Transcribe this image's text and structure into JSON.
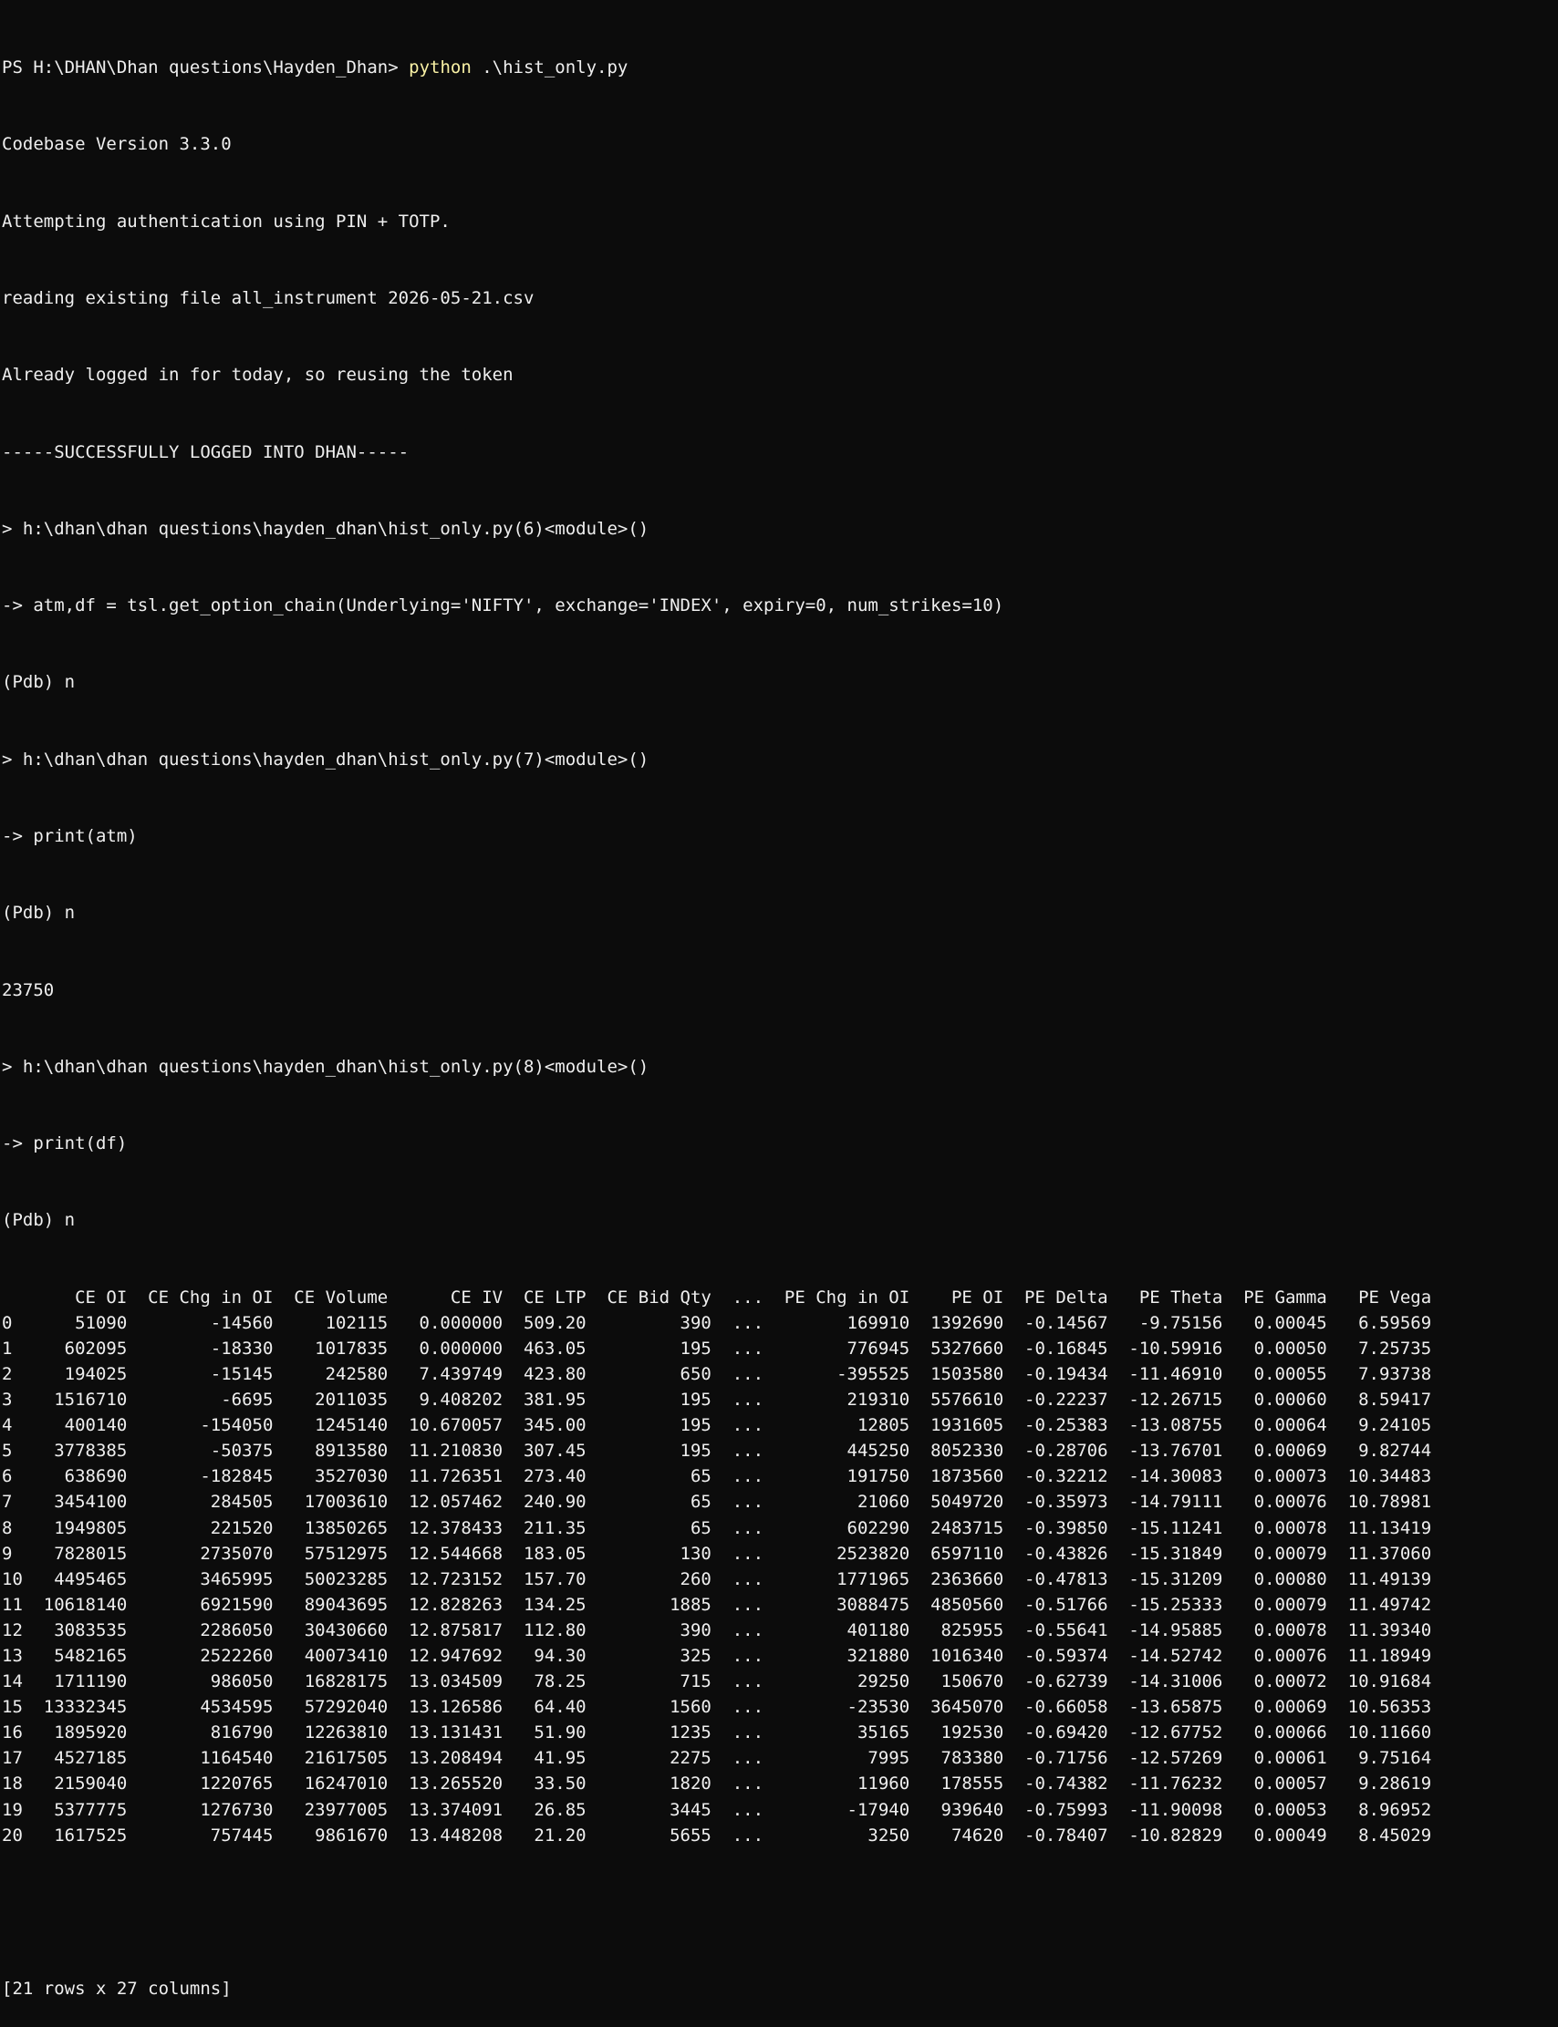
{
  "prompt": {
    "path": "PS H:\\DHAN\\Dhan questions\\Hayden_Dhan>",
    "command": "python",
    "args": " .\\hist_only.py"
  },
  "output_lines": [
    "Codebase Version 3.3.0",
    "Attempting authentication using PIN + TOTP.",
    "reading existing file all_instrument 2026-05-21.csv",
    "Already logged in for today, so reusing the token",
    "-----SUCCESSFULLY LOGGED INTO DHAN-----",
    "> h:\\dhan\\dhan questions\\hayden_dhan\\hist_only.py(6)<module>()",
    "-> atm,df = tsl.get_option_chain(Underlying='NIFTY', exchange='INDEX', expiry=0, num_strikes=10)",
    "(Pdb) n",
    "> h:\\dhan\\dhan questions\\hayden_dhan\\hist_only.py(7)<module>()",
    "-> print(atm)",
    "(Pdb) n",
    "23750",
    "> h:\\dhan\\dhan questions\\hayden_dhan\\hist_only.py(8)<module>()",
    "-> print(df)",
    "(Pdb) n"
  ],
  "table": {
    "columns": [
      "",
      "CE OI",
      "CE Chg in OI",
      "CE Volume",
      "CE IV",
      "CE LTP",
      "CE Bid Qty",
      "...",
      "PE Chg in OI",
      "PE OI",
      "PE Delta",
      "PE Theta",
      "PE Gamma",
      "PE Vega"
    ],
    "rows": [
      [
        "0",
        "51090",
        "-14560",
        "102115",
        "0.000000",
        "509.20",
        "390",
        "...",
        "169910",
        "1392690",
        "-0.14567",
        "-9.75156",
        "0.00045",
        "6.59569"
      ],
      [
        "1",
        "602095",
        "-18330",
        "1017835",
        "0.000000",
        "463.05",
        "195",
        "...",
        "776945",
        "5327660",
        "-0.16845",
        "-10.59916",
        "0.00050",
        "7.25735"
      ],
      [
        "2",
        "194025",
        "-15145",
        "242580",
        "7.439749",
        "423.80",
        "650",
        "...",
        "-395525",
        "1503580",
        "-0.19434",
        "-11.46910",
        "0.00055",
        "7.93738"
      ],
      [
        "3",
        "1516710",
        "-6695",
        "2011035",
        "9.408202",
        "381.95",
        "195",
        "...",
        "219310",
        "5576610",
        "-0.22237",
        "-12.26715",
        "0.00060",
        "8.59417"
      ],
      [
        "4",
        "400140",
        "-154050",
        "1245140",
        "10.670057",
        "345.00",
        "195",
        "...",
        "12805",
        "1931605",
        "-0.25383",
        "-13.08755",
        "0.00064",
        "9.24105"
      ],
      [
        "5",
        "3778385",
        "-50375",
        "8913580",
        "11.210830",
        "307.45",
        "195",
        "...",
        "445250",
        "8052330",
        "-0.28706",
        "-13.76701",
        "0.00069",
        "9.82744"
      ],
      [
        "6",
        "638690",
        "-182845",
        "3527030",
        "11.726351",
        "273.40",
        "65",
        "...",
        "191750",
        "1873560",
        "-0.32212",
        "-14.30083",
        "0.00073",
        "10.34483"
      ],
      [
        "7",
        "3454100",
        "284505",
        "17003610",
        "12.057462",
        "240.90",
        "65",
        "...",
        "21060",
        "5049720",
        "-0.35973",
        "-14.79111",
        "0.00076",
        "10.78981"
      ],
      [
        "8",
        "1949805",
        "221520",
        "13850265",
        "12.378433",
        "211.35",
        "65",
        "...",
        "602290",
        "2483715",
        "-0.39850",
        "-15.11241",
        "0.00078",
        "11.13419"
      ],
      [
        "9",
        "7828015",
        "2735070",
        "57512975",
        "12.544668",
        "183.05",
        "130",
        "...",
        "2523820",
        "6597110",
        "-0.43826",
        "-15.31849",
        "0.00079",
        "11.37060"
      ],
      [
        "10",
        "4495465",
        "3465995",
        "50023285",
        "12.723152",
        "157.70",
        "260",
        "...",
        "1771965",
        "2363660",
        "-0.47813",
        "-15.31209",
        "0.00080",
        "11.49139"
      ],
      [
        "11",
        "10618140",
        "6921590",
        "89043695",
        "12.828263",
        "134.25",
        "1885",
        "...",
        "3088475",
        "4850560",
        "-0.51766",
        "-15.25333",
        "0.00079",
        "11.49742"
      ],
      [
        "12",
        "3083535",
        "2286050",
        "30430660",
        "12.875817",
        "112.80",
        "390",
        "...",
        "401180",
        "825955",
        "-0.55641",
        "-14.95885",
        "0.00078",
        "11.39340"
      ],
      [
        "13",
        "5482165",
        "2522260",
        "40073410",
        "12.947692",
        "94.30",
        "325",
        "...",
        "321880",
        "1016340",
        "-0.59374",
        "-14.52742",
        "0.00076",
        "11.18949"
      ],
      [
        "14",
        "1711190",
        "986050",
        "16828175",
        "13.034509",
        "78.25",
        "715",
        "...",
        "29250",
        "150670",
        "-0.62739",
        "-14.31006",
        "0.00072",
        "10.91684"
      ],
      [
        "15",
        "13332345",
        "4534595",
        "57292040",
        "13.126586",
        "64.40",
        "1560",
        "...",
        "-23530",
        "3645070",
        "-0.66058",
        "-13.65875",
        "0.00069",
        "10.56353"
      ],
      [
        "16",
        "1895920",
        "816790",
        "12263810",
        "13.131431",
        "51.90",
        "1235",
        "...",
        "35165",
        "192530",
        "-0.69420",
        "-12.67752",
        "0.00066",
        "10.11660"
      ],
      [
        "17",
        "4527185",
        "1164540",
        "21617505",
        "13.208494",
        "41.95",
        "2275",
        "...",
        "7995",
        "783380",
        "-0.71756",
        "-12.57269",
        "0.00061",
        "9.75164"
      ],
      [
        "18",
        "2159040",
        "1220765",
        "16247010",
        "13.265520",
        "33.50",
        "1820",
        "...",
        "11960",
        "178555",
        "-0.74382",
        "-11.76232",
        "0.00057",
        "9.28619"
      ],
      [
        "19",
        "5377775",
        "1276730",
        "23977005",
        "13.374091",
        "26.85",
        "3445",
        "...",
        "-17940",
        "939640",
        "-0.75993",
        "-11.90098",
        "0.00053",
        "8.96952"
      ],
      [
        "20",
        "1617525",
        "757445",
        "9861670",
        "13.448208",
        "21.20",
        "5655",
        "...",
        "3250",
        "74620",
        "-0.78407",
        "-10.82829",
        "0.00049",
        "8.45029"
      ]
    ]
  },
  "footer": "[21 rows x 27 columns]"
}
